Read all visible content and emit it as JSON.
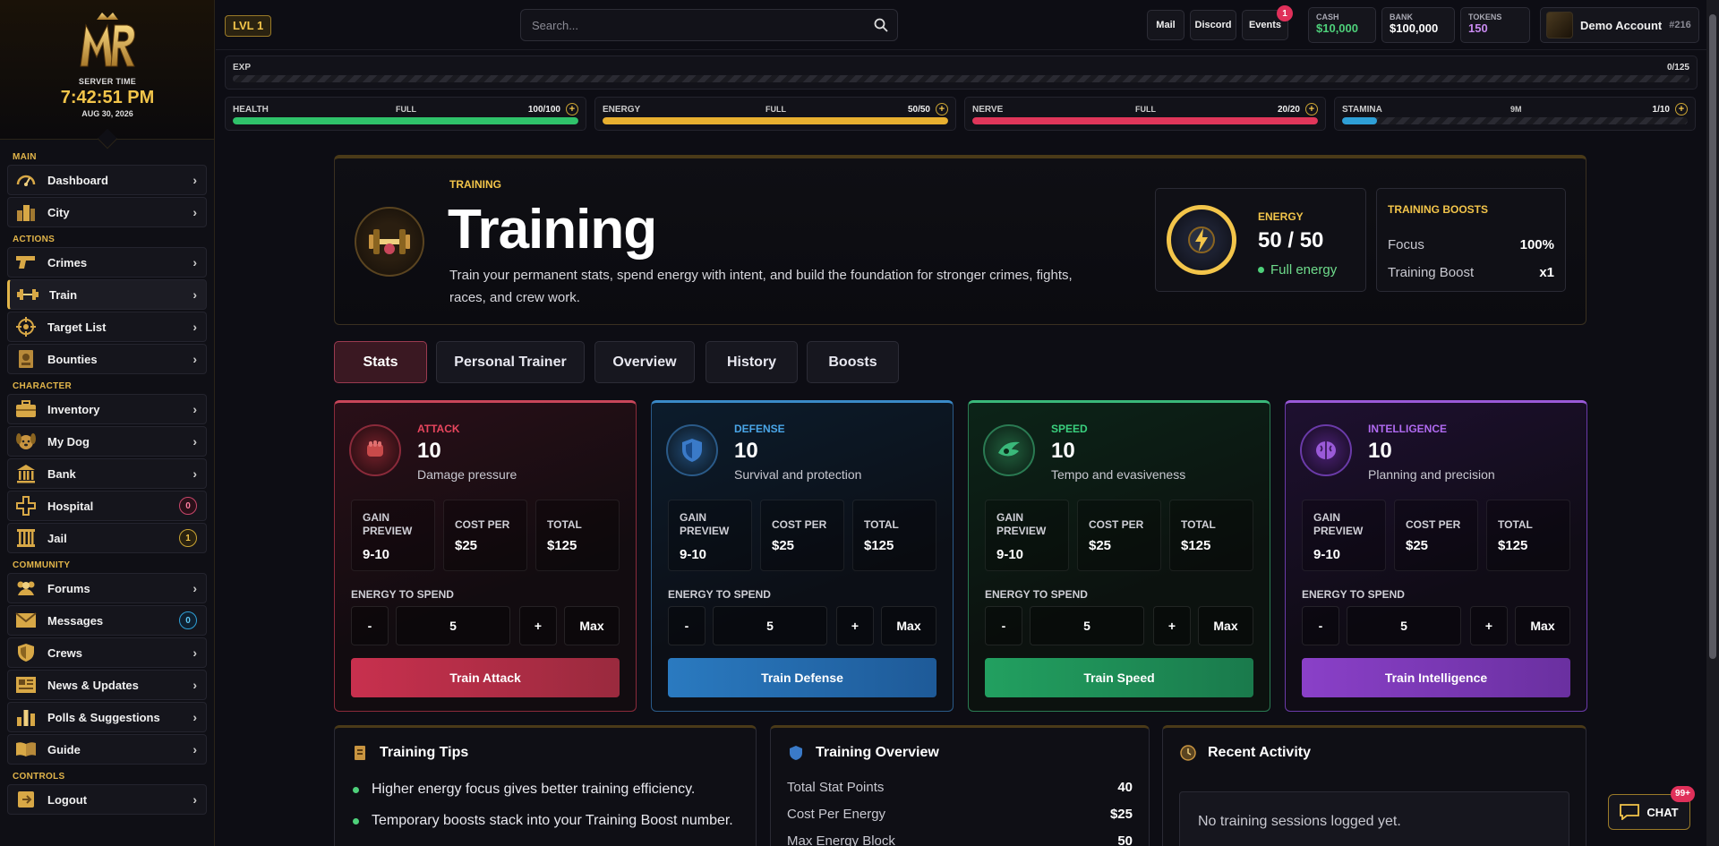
{
  "sidebar": {
    "server_time_label": "SERVER TIME",
    "server_time": "7:42:51 PM",
    "server_date": "AUG 30, 2026",
    "sections": {
      "main": "MAIN",
      "actions": "ACTIONS",
      "character": "CHARACTER",
      "community": "COMMUNITY",
      "controls": "CONTROLS"
    },
    "items": [
      {
        "label": "Dashboard",
        "icon": "speedometer-icon"
      },
      {
        "label": "City",
        "icon": "city-icon"
      },
      {
        "label": "Crimes",
        "icon": "pistol-icon"
      },
      {
        "label": "Train",
        "icon": "dumbbell-icon"
      },
      {
        "label": "Target List",
        "icon": "crosshair-icon"
      },
      {
        "label": "Bounties",
        "icon": "bounty-poster-icon"
      },
      {
        "label": "Inventory",
        "icon": "briefcase-icon"
      },
      {
        "label": "My Dog",
        "icon": "dog-icon"
      },
      {
        "label": "Bank",
        "icon": "bank-icon"
      },
      {
        "label": "Hospital",
        "icon": "medical-cross-icon",
        "badge": "0"
      },
      {
        "label": "Jail",
        "icon": "jail-bars-icon",
        "badge": "1"
      },
      {
        "label": "Forums",
        "icon": "people-icon"
      },
      {
        "label": "Messages",
        "icon": "envelope-icon",
        "badge": "0"
      },
      {
        "label": "Crews",
        "icon": "shield-icon"
      },
      {
        "label": "News & Updates",
        "icon": "newspaper-icon"
      },
      {
        "label": "Polls & Suggestions",
        "icon": "bar-chart-icon"
      },
      {
        "label": "Guide",
        "icon": "book-icon"
      },
      {
        "label": "Logout",
        "icon": "logout-icon"
      }
    ]
  },
  "topbar": {
    "level": "LVL 1",
    "search_placeholder": "Search...",
    "mail": "Mail",
    "discord": "Discord",
    "events": "Events",
    "events_badge": "1",
    "cash_label": "CASH",
    "cash_value": "$10,000",
    "bank_label": "BANK",
    "bank_value": "$100,000",
    "tokens_label": "TOKENS",
    "tokens_value": "150",
    "account_name": "Demo Account",
    "account_id": "#216"
  },
  "exp": {
    "label": "EXP",
    "value": "0/125",
    "fraction": 0
  },
  "stat_bars": [
    {
      "name": "HEALTH",
      "status": "FULL",
      "value": "100/100",
      "fraction": 1.0,
      "color": "#2fc26a"
    },
    {
      "name": "ENERGY",
      "status": "FULL",
      "value": "50/50",
      "fraction": 1.0,
      "color": "#e8b030"
    },
    {
      "name": "NERVE",
      "status": "FULL",
      "value": "20/20",
      "fraction": 1.0,
      "color": "#e0365a"
    },
    {
      "name": "STAMINA",
      "status": "9M",
      "value": "1/10",
      "fraction": 0.1,
      "color": "#2e9fd6"
    }
  ],
  "hero": {
    "kicker": "TRAINING",
    "title": "Training",
    "description": "Train your permanent stats, spend energy with intent, and build the foundation for stronger crimes, fights, races, and crew work.",
    "energy_label": "ENERGY",
    "energy_value": "50 / 50",
    "energy_status": "Full energy",
    "boosts_title": "TRAINING BOOSTS",
    "focus_label": "Focus",
    "focus_value": "100%",
    "boost_label": "Training Boost",
    "boost_value": "x1"
  },
  "tabs": [
    "Stats",
    "Personal Trainer",
    "Overview",
    "History",
    "Boosts"
  ],
  "labels": {
    "gain_preview": "GAIN PREVIEW",
    "cost_per": "COST PER",
    "total": "TOTAL",
    "energy_to_spend": "ENERGY TO SPEND",
    "minus": "-",
    "plus": "+",
    "max": "Max"
  },
  "stats": [
    {
      "key": "attack",
      "kicker": "ATTACK",
      "value": "10",
      "desc": "Damage pressure",
      "gain": "9-10",
      "cost": "$25",
      "total": "$125",
      "energy": "5",
      "button": "Train Attack",
      "color": "#e8465e"
    },
    {
      "key": "defense",
      "kicker": "DEFENSE",
      "value": "10",
      "desc": "Survival and protection",
      "gain": "9-10",
      "cost": "$25",
      "total": "$125",
      "energy": "5",
      "button": "Train Defense",
      "color": "#4aa6e8"
    },
    {
      "key": "speed",
      "kicker": "SPEED",
      "value": "10",
      "desc": "Tempo and evasiveness",
      "gain": "9-10",
      "cost": "$25",
      "total": "$125",
      "energy": "5",
      "button": "Train Speed",
      "color": "#3ad07e"
    },
    {
      "key": "intel",
      "kicker": "INTELLIGENCE",
      "value": "10",
      "desc": "Planning and precision",
      "gain": "9-10",
      "cost": "$25",
      "total": "$125",
      "energy": "5",
      "button": "Train Intelligence",
      "color": "#b06af0"
    }
  ],
  "panels": {
    "tips_title": "Training Tips",
    "tips": [
      "Higher energy focus gives better training efficiency.",
      "Temporary boosts stack into your Training Boost number."
    ],
    "overview_title": "Training Overview",
    "overview": [
      {
        "k": "Total Stat Points",
        "v": "40"
      },
      {
        "k": "Cost Per Energy",
        "v": "$25"
      },
      {
        "k": "Max Energy Block",
        "v": "50"
      }
    ],
    "activity_title": "Recent Activity",
    "activity_empty": "No training sessions logged yet."
  },
  "chat": {
    "label": "CHAT",
    "badge": "99+"
  }
}
